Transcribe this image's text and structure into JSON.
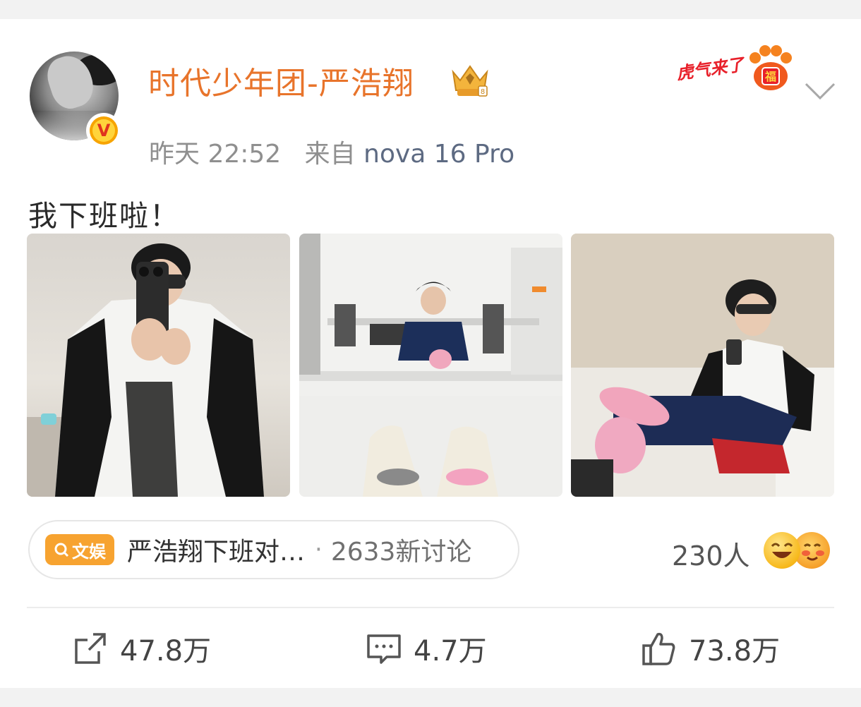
{
  "post": {
    "username": "时代少年团-严浩翔",
    "timestamp": "昨天 22:52",
    "source_prefix": "来自",
    "device": "nova 16 Pro",
    "text": "我下班啦！",
    "sticker_text": "虎气来了",
    "sticker_char": "福"
  },
  "hashtag": {
    "badge_label": "文娱",
    "text": "严浩翔下班对…",
    "separator": "·",
    "count": "2633新讨论"
  },
  "reactions": {
    "count": "230人"
  },
  "actions": {
    "repost": "47.8万",
    "comment": "4.7万",
    "like": "73.8万"
  },
  "colors": {
    "username": "#e8742b",
    "badge": "#f7a330",
    "device": "#5d6a82"
  },
  "icons": [
    "avatar",
    "verified-v-icon",
    "crown-icon",
    "chevron-down-icon",
    "search-icon",
    "repost-icon",
    "comment-icon",
    "like-icon"
  ]
}
